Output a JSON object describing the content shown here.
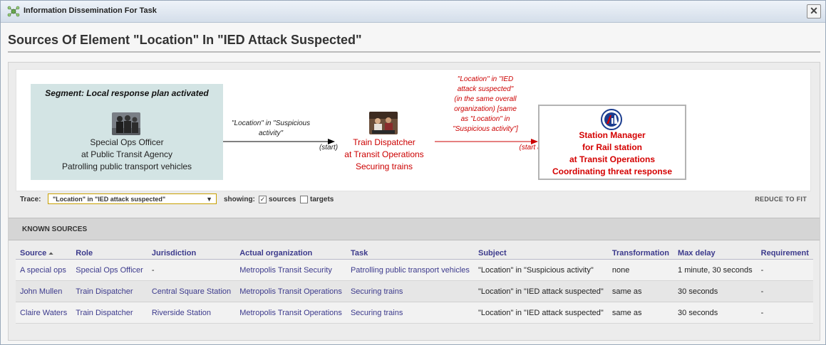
{
  "window": {
    "title": "Information Dissemination For Task",
    "close_icon": "close-icon",
    "app_icon": "network-icon"
  },
  "page": {
    "heading": "Sources Of Element \"Location\" In \"IED Attack Suspected\""
  },
  "graph": {
    "segment_title": "Segment: Local response plan activated",
    "source_node": {
      "lines": [
        "Special Ops Officer",
        "at Public Transit Agency",
        "Patrolling public transport vehicles"
      ],
      "icon": "people-photo"
    },
    "edge1": {
      "label_lines": [
        "\"Location\" in \"Suspicious",
        "activity\""
      ],
      "tag": "(start)",
      "color": "#000000"
    },
    "middle_node": {
      "lines": [
        "Train Dispatcher",
        "at Transit Operations",
        "Securing trains"
      ],
      "color": "#cc0000",
      "icon": "dispatcher-photo"
    },
    "edge2": {
      "label_lines": [
        "\"Location\" in \"IED",
        "attack suspected\"",
        "(in the same overall",
        "organization) [same",
        "as \"Location\" in",
        "\"Suspicious activity\"]"
      ],
      "tag": "(start all)",
      "color": "#cc0000"
    },
    "target_node": {
      "lines": [
        "Station Manager",
        "for Rail station",
        "at Transit Operations",
        "Coordinating threat response"
      ],
      "color": "#d40000",
      "icon": "transit-logo-icon"
    }
  },
  "trace": {
    "label": "Trace:",
    "selected": "\"Location\" in \"IED attack suspected\"",
    "showing_label": "showing:",
    "sources_label": "sources",
    "sources_checked": true,
    "targets_label": "targets",
    "targets_checked": false,
    "reduce_label": "REDUCE TO FIT"
  },
  "known_sources": {
    "title": "KNOWN SOURCES",
    "columns": [
      "Source",
      "Role",
      "Jurisdiction",
      "Actual organization",
      "Task",
      "Subject",
      "Transformation",
      "Max delay",
      "Requirement"
    ],
    "sort_icon": "sort-ascending-icon",
    "rows": [
      [
        "A special ops",
        "Special Ops Officer",
        "-",
        "Metropolis Transit Security",
        "Patrolling public transport vehicles",
        "\"Location\" in \"Suspicious activity\"",
        "none",
        "1 minute, 30 seconds",
        "-"
      ],
      [
        "John Mullen",
        "Train Dispatcher",
        "Central Square Station",
        "Metropolis Transit Operations",
        "Securing trains",
        "\"Location\" in \"IED attack suspected\"",
        "same as",
        "30 seconds",
        "-"
      ],
      [
        "Claire Waters",
        "Train Dispatcher",
        "Riverside Station",
        "Metropolis Transit Operations",
        "Securing trains",
        "\"Location\" in \"IED attack suspected\"",
        "same as",
        "30 seconds",
        "-"
      ]
    ]
  },
  "colors": {
    "link": "#3c3a8c",
    "accent_red": "#cc0000",
    "segment_bg": "#d3e4e4"
  }
}
